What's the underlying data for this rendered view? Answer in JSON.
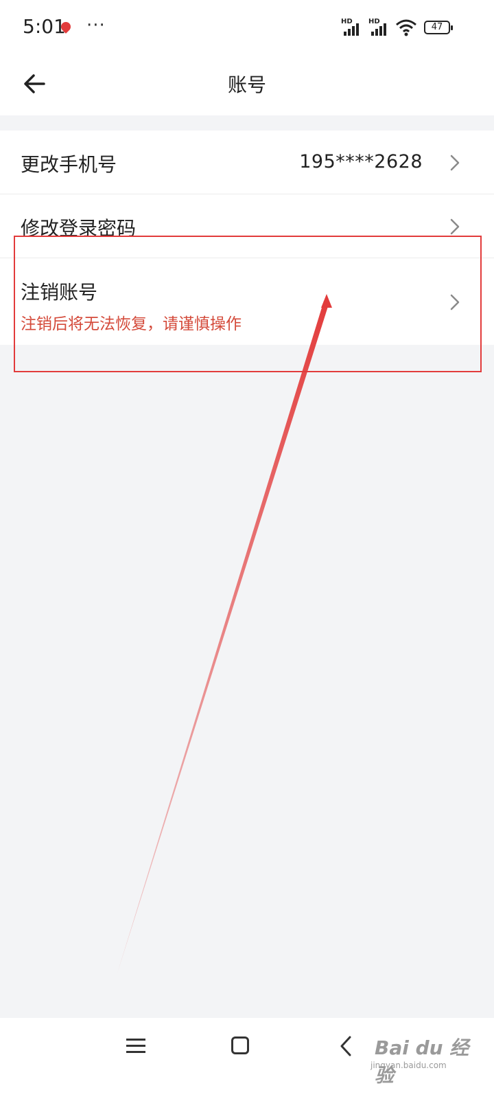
{
  "status_bar": {
    "time": "5:01",
    "more": "···",
    "signal_1_label": "HD",
    "signal_2_label": "HD",
    "battery": "47"
  },
  "header": {
    "title": "账号"
  },
  "settings": {
    "items": [
      {
        "label": "更改手机号",
        "value": "195****2628"
      },
      {
        "label": "修改登录密码"
      },
      {
        "label": "注销账号",
        "warning": "注销后将无法恢复，请谨慎操作"
      }
    ]
  },
  "colors": {
    "accent_red": "#e23b3b",
    "warning_text": "#d44a3a",
    "background": "#f3f4f6"
  },
  "icons": [
    "back-arrow-icon",
    "chevron-right-icon",
    "menu-icon",
    "home-icon",
    "back-nav-icon",
    "wifi-icon",
    "signal-icon",
    "battery-icon"
  ],
  "watermark": {
    "text": "Bai du 经验",
    "sub": "jingyan.baidu.com"
  }
}
